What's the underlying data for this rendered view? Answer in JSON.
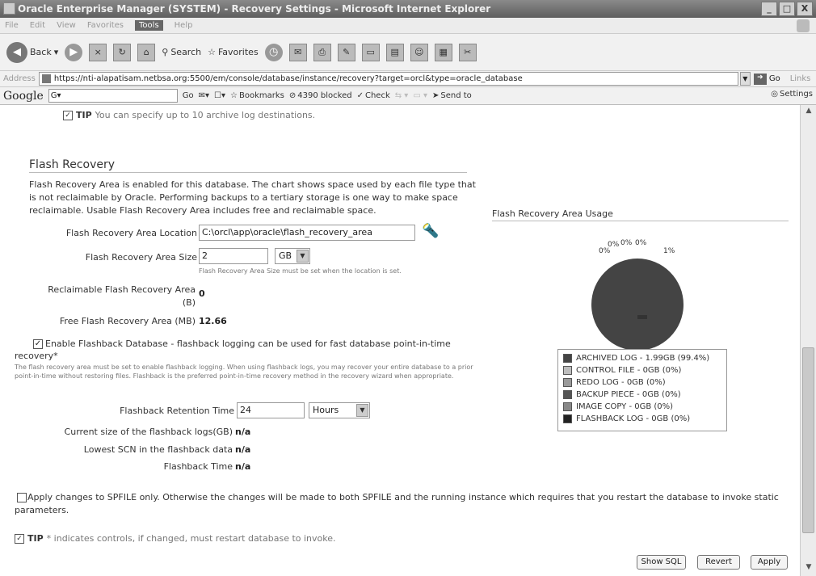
{
  "window": {
    "title": "Oracle Enterprise Manager (SYSTEM) - Recovery Settings - Microsoft Internet Explorer",
    "minimize": "_",
    "maximize": "□",
    "close": "X"
  },
  "menu": [
    "File",
    "Edit",
    "View",
    "Favorites",
    "Tools",
    "Help"
  ],
  "toolbar": {
    "back": "Back",
    "search": "Search",
    "favorites": "Favorites"
  },
  "address": {
    "label": "Address",
    "url": "https://nti-alapatisam.netbsa.org:5500/em/console/database/instance/recovery?target=orcl&type=oracle_database",
    "go": "Go",
    "links": "Links"
  },
  "googlebar": {
    "logo": "Google",
    "go": "Go",
    "bookmarks": "Bookmarks",
    "blocked": "4390 blocked",
    "check": "Check",
    "send_to": "Send to",
    "settings": "Settings"
  },
  "tip_top": {
    "label": "TIP",
    "text": "You can specify up to 10 archive log destinations."
  },
  "flash": {
    "heading": "Flash Recovery",
    "description": "Flash Recovery Area is enabled for this database. The chart shows space used by each file type that is not reclaimable by Oracle. Performing backups to a tertiary storage is one way to make space reclaimable. Usable Flash Recovery Area includes free and reclaimable space.",
    "location_label": "Flash Recovery Area Location",
    "location_value": "C:\\orcl\\app\\oracle\\flash_recovery_area",
    "size_label": "Flash Recovery Area Size",
    "size_value": "2",
    "size_unit": "GB",
    "size_hint": "Flash Recovery Area Size must be set when the location is set.",
    "reclaimable_label": "Reclaimable Flash Recovery Area",
    "reclaimable_unit": "(B)",
    "reclaimable_value": "0",
    "free_label": "Free Flash Recovery Area (MB)",
    "free_value": "12.66",
    "enable_label": "Enable Flashback Database - flashback logging can be used for fast database point-in-time recovery*",
    "enable_note": "The flash recovery area must be set to enable flashback logging. When using flashback logs, you may recover your entire database to a prior point-in-time without restoring files. Flashback is the preferred point-in-time recovery method in the recovery wizard when appropriate.",
    "retention_label": "Flashback Retention Time",
    "retention_value": "24",
    "retention_unit": "Hours",
    "current_size_label": "Current size of the flashback logs(GB)",
    "current_size_value": "n/a",
    "lowest_scn_label": "Lowest SCN in the flashback data",
    "lowest_scn_value": "n/a",
    "flashback_time_label": "Flashback Time",
    "flashback_time_value": "n/a"
  },
  "spfile": {
    "label": "Apply changes to SPFILE only. Otherwise the changes will be made to both SPFILE and the running instance which requires that you restart the database to invoke static parameters."
  },
  "tip_bottom": {
    "label": "TIP",
    "text": "* indicates controls, if changed, must restart database to invoke."
  },
  "buttons": {
    "show_sql": "Show SQL",
    "revert": "Revert",
    "apply": "Apply"
  },
  "chart_data": {
    "type": "pie",
    "title": "Flash Recovery Area Usage",
    "slice_labels": [
      "0%",
      "0%",
      "0%",
      "0%",
      "1%"
    ],
    "series": [
      {
        "name": "ARCHIVED LOG - 1.99GB (99.4%)",
        "value": 99.4,
        "color": "#444444"
      },
      {
        "name": "CONTROL FILE - 0GB (0%)",
        "value": 0,
        "color": "#bdbdbd"
      },
      {
        "name": "REDO LOG - 0GB (0%)",
        "value": 0,
        "color": "#9a9a9a"
      },
      {
        "name": "BACKUP PIECE - 0GB (0%)",
        "value": 0,
        "color": "#555555"
      },
      {
        "name": "IMAGE COPY - 0GB (0%)",
        "value": 0,
        "color": "#888888"
      },
      {
        "name": "FLASHBACK LOG - 0GB (0%)",
        "value": 0,
        "color": "#222222"
      }
    ]
  }
}
